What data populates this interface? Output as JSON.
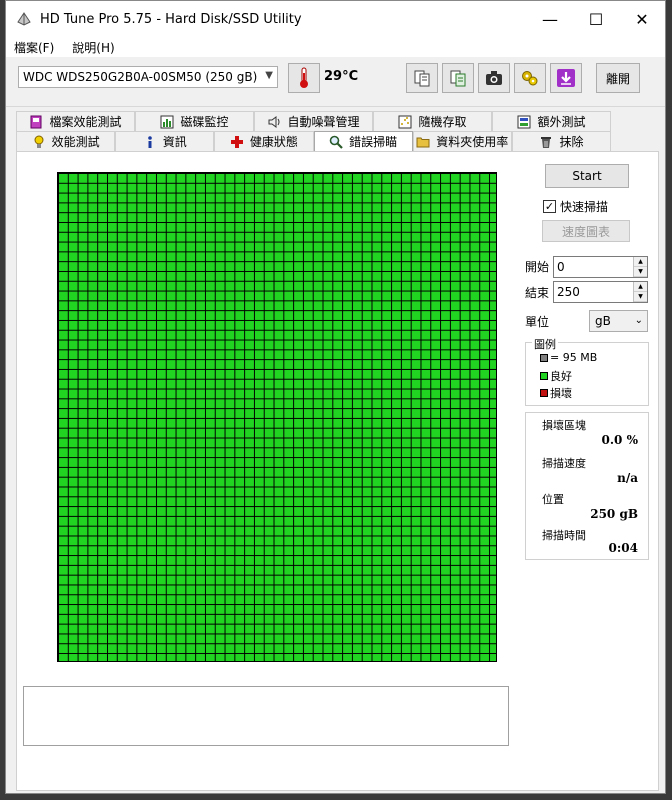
{
  "window": {
    "title": "HD Tune Pro 5.75 - Hard Disk/SSD Utility",
    "minimize_label": "—",
    "maximize_label": "☐",
    "close_label": "✕"
  },
  "menu": [
    "檔案(F)",
    "說明(H)"
  ],
  "toolbar": {
    "drive": "WDC  WDS250G2B0A-00SM50 (250 gB)",
    "temperature": "29°C",
    "exit_label": "離開"
  },
  "tabs_row1": [
    {
      "label": "檔案效能測試",
      "icon": "file-benchmark-icon"
    },
    {
      "label": "磁碟監控",
      "icon": "disk-monitor-icon"
    },
    {
      "label": "自動噪聲管理",
      "icon": "speaker-icon"
    },
    {
      "label": "隨機存取",
      "icon": "random-access-icon"
    },
    {
      "label": "額外測試",
      "icon": "extra-tests-icon"
    }
  ],
  "tabs_row2": [
    {
      "label": "效能測試",
      "icon": "benchmark-icon"
    },
    {
      "label": "資訊",
      "icon": "info-icon"
    },
    {
      "label": "健康狀態",
      "icon": "health-icon"
    },
    {
      "label": "錯誤掃瞄",
      "icon": "magnifier-icon"
    },
    {
      "label": "資料夾使用率",
      "icon": "folder-icon"
    },
    {
      "label": "抹除",
      "icon": "trash-icon"
    }
  ],
  "active_tab": "錯誤掃瞄",
  "controls": {
    "start_label": "Start",
    "quick_scan_label": "快速掃描",
    "quick_scan_checked": true,
    "speed_map_label": "速度圖表",
    "start_field_label": "開始",
    "start_value": "0",
    "end_field_label": "結束",
    "end_value": "250",
    "unit_label": "單位",
    "unit_value": "gB"
  },
  "legend": {
    "title": "圖例",
    "block_size": "= 95 MB",
    "good_label": "良好",
    "damaged_label": "損壞",
    "colors": {
      "block": "#808080",
      "good": "#22d422",
      "damaged": "#c01010"
    }
  },
  "stats": {
    "damaged_blocks_label": "損壞區塊",
    "damaged_blocks_value": "0.0 %",
    "scan_speed_label": "掃描速度",
    "scan_speed_value": "n/a",
    "position_label": "位置",
    "position_value": "250 gB",
    "elapsed_label": "掃描時間",
    "elapsed_value": "0:04"
  },
  "scan_grid": {
    "state": "good",
    "color": "#22d422"
  }
}
